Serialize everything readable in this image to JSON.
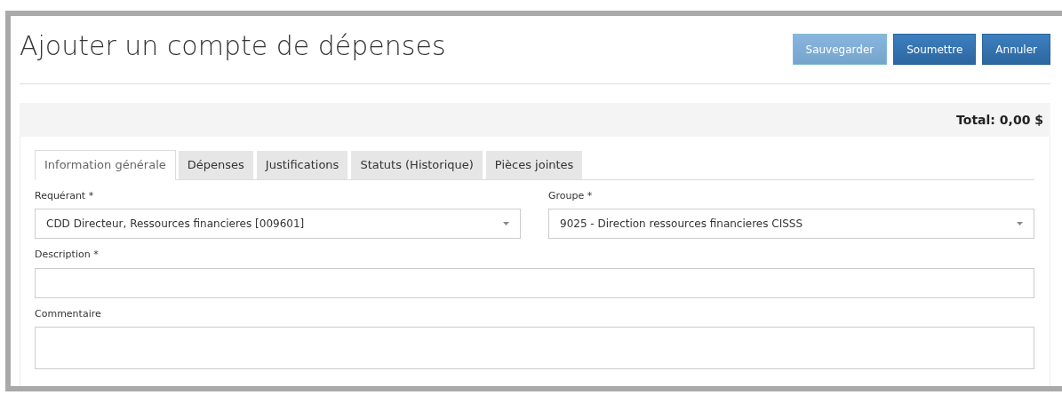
{
  "title": "Ajouter un compte de dépenses",
  "buttons": [
    {
      "label": "Sauvegarder",
      "disabled": true
    },
    {
      "label": "Soumettre",
      "disabled": false
    },
    {
      "label": "Annuler",
      "disabled": false
    }
  ],
  "total": "Total: 0,00 $",
  "tabs": [
    {
      "label": "Information générale",
      "selected": true
    },
    {
      "label": "Dépenses",
      "selected": false
    },
    {
      "label": "Justifications",
      "selected": false
    },
    {
      "label": "Statuts (Historique)",
      "selected": false
    },
    {
      "label": "Pièces jointes",
      "selected": false
    }
  ],
  "fields": [
    {
      "kind": "select",
      "label": "Requérant *",
      "value": "CDD Directeur, Ressources financieres [009601]"
    },
    {
      "kind": "select",
      "label": "Groupe *",
      "value": "9025 - Direction ressources financieres CISSS"
    },
    {
      "kind": "text",
      "label": "Description *"
    },
    {
      "kind": "textarea",
      "label": "Commentaire"
    }
  ]
}
